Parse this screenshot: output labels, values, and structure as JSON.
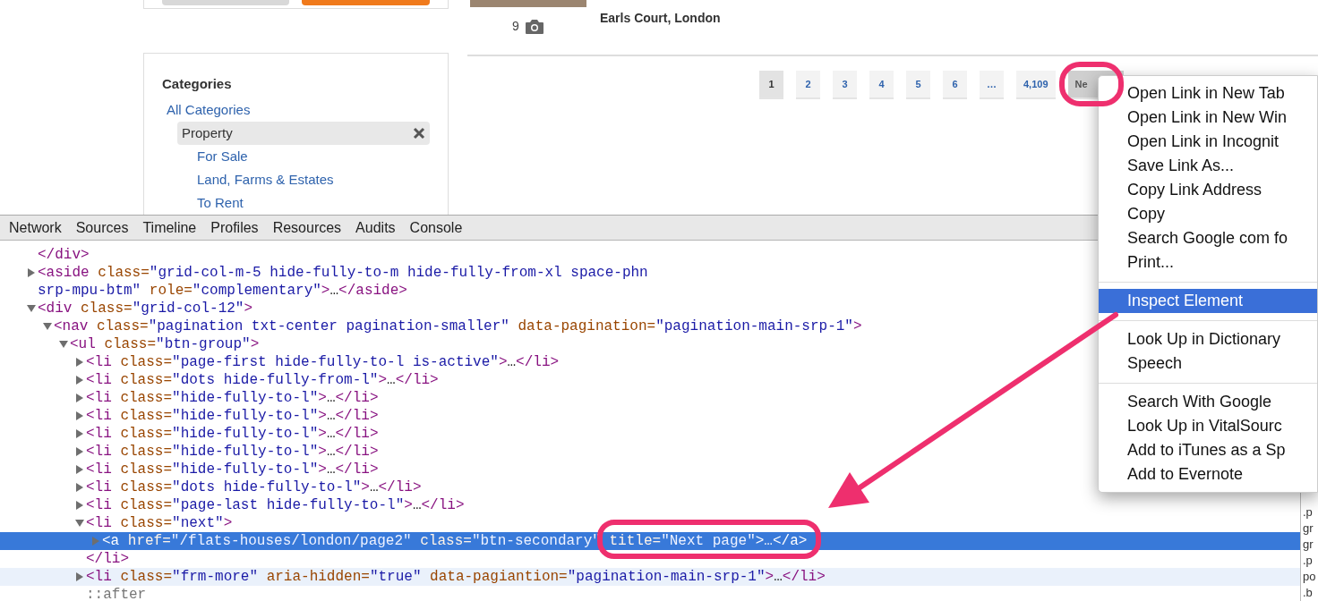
{
  "sidebar": {
    "title": "Categories",
    "items": [
      {
        "label": "All Categories",
        "selected": false,
        "children": [
          {
            "label": "Property",
            "selected": true,
            "children": [
              {
                "label": "For Sale",
                "selected": false
              },
              {
                "label": "Land, Farms & Estates",
                "selected": false
              },
              {
                "label": "To Rent",
                "selected": false
              }
            ]
          }
        ]
      }
    ]
  },
  "listing": {
    "photo_count": "9",
    "location": "Earls Court, London"
  },
  "pagination": [
    {
      "label": "1",
      "selected": true
    },
    {
      "label": "2",
      "selected": false
    },
    {
      "label": "3",
      "selected": false
    },
    {
      "label": "4",
      "selected": false
    },
    {
      "label": "5",
      "selected": false
    },
    {
      "label": "6",
      "selected": false
    },
    {
      "label": "…",
      "selected": false
    },
    {
      "label": "4,109",
      "selected": false
    },
    {
      "label": "Ne",
      "selected": false
    }
  ],
  "devtools": {
    "tabs": [
      "Network",
      "Sources",
      "Timeline",
      "Profiles",
      "Resources",
      "Audits",
      "Console"
    ],
    "tree": [
      {
        "selected": false,
        "hovered": false,
        "tokens": [
          {
            "kind": "tag",
            "text": "</div>"
          }
        ]
      },
      {
        "selected": false,
        "hovered": false,
        "expanded": false,
        "tokens": [
          {
            "kind": "tag",
            "text": "<aside"
          },
          {
            "kind": "attr",
            "text": " class="
          },
          {
            "kind": "value",
            "text": "\"grid-col-m-5 hide-fully-to-m hide-fully-from-xl space-phn srp-mpu-btm\""
          },
          {
            "kind": "attr",
            "text": " role="
          },
          {
            "kind": "value",
            "text": "\"complementary\""
          },
          {
            "kind": "tag",
            "text": ">"
          },
          {
            "kind": "text",
            "text": "…"
          },
          {
            "kind": "tag",
            "text": "</aside>"
          }
        ]
      },
      {
        "selected": false,
        "hovered": false,
        "expanded": true,
        "tokens": [
          {
            "kind": "tag",
            "text": "<div"
          },
          {
            "kind": "attr",
            "text": " class="
          },
          {
            "kind": "value",
            "text": "\"grid-col-12\""
          },
          {
            "kind": "tag",
            "text": ">"
          }
        ],
        "children": [
          {
            "selected": false,
            "hovered": false,
            "expanded": true,
            "tokens": [
              {
                "kind": "tag",
                "text": "<nav"
              },
              {
                "kind": "attr",
                "text": " class="
              },
              {
                "kind": "value",
                "text": "\"pagination txt-center pagination-smaller\""
              },
              {
                "kind": "attr",
                "text": " data-pagination="
              },
              {
                "kind": "value",
                "text": "\"pagination-main-srp-1\""
              },
              {
                "kind": "tag",
                "text": ">"
              }
            ],
            "children": [
              {
                "selected": false,
                "hovered": false,
                "expanded": true,
                "tokens": [
                  {
                    "kind": "tag",
                    "text": "<ul"
                  },
                  {
                    "kind": "attr",
                    "text": " class="
                  },
                  {
                    "kind": "value",
                    "text": "\"btn-group\""
                  },
                  {
                    "kind": "tag",
                    "text": ">"
                  }
                ],
                "children": [
                  {
                    "selected": false,
                    "hovered": false,
                    "expanded": false,
                    "tokens": [
                      {
                        "kind": "tag",
                        "text": "<li"
                      },
                      {
                        "kind": "attr",
                        "text": " class="
                      },
                      {
                        "kind": "value",
                        "text": "\"page-first hide-fully-to-l is-active\""
                      },
                      {
                        "kind": "tag",
                        "text": ">"
                      },
                      {
                        "kind": "text",
                        "text": "…"
                      },
                      {
                        "kind": "tag",
                        "text": "</li>"
                      }
                    ]
                  },
                  {
                    "selected": false,
                    "hovered": false,
                    "expanded": false,
                    "tokens": [
                      {
                        "kind": "tag",
                        "text": "<li"
                      },
                      {
                        "kind": "attr",
                        "text": " class="
                      },
                      {
                        "kind": "value",
                        "text": "\"dots hide-fully-from-l\""
                      },
                      {
                        "kind": "tag",
                        "text": ">"
                      },
                      {
                        "kind": "text",
                        "text": "…"
                      },
                      {
                        "kind": "tag",
                        "text": "</li>"
                      }
                    ]
                  },
                  {
                    "selected": false,
                    "hovered": false,
                    "expanded": false,
                    "tokens": [
                      {
                        "kind": "tag",
                        "text": "<li"
                      },
                      {
                        "kind": "attr",
                        "text": " class="
                      },
                      {
                        "kind": "value",
                        "text": "\"hide-fully-to-l\""
                      },
                      {
                        "kind": "tag",
                        "text": ">"
                      },
                      {
                        "kind": "text",
                        "text": "…"
                      },
                      {
                        "kind": "tag",
                        "text": "</li>"
                      }
                    ]
                  },
                  {
                    "selected": false,
                    "hovered": false,
                    "expanded": false,
                    "tokens": [
                      {
                        "kind": "tag",
                        "text": "<li"
                      },
                      {
                        "kind": "attr",
                        "text": " class="
                      },
                      {
                        "kind": "value",
                        "text": "\"hide-fully-to-l\""
                      },
                      {
                        "kind": "tag",
                        "text": ">"
                      },
                      {
                        "kind": "text",
                        "text": "…"
                      },
                      {
                        "kind": "tag",
                        "text": "</li>"
                      }
                    ]
                  },
                  {
                    "selected": false,
                    "hovered": false,
                    "expanded": false,
                    "tokens": [
                      {
                        "kind": "tag",
                        "text": "<li"
                      },
                      {
                        "kind": "attr",
                        "text": " class="
                      },
                      {
                        "kind": "value",
                        "text": "\"hide-fully-to-l\""
                      },
                      {
                        "kind": "tag",
                        "text": ">"
                      },
                      {
                        "kind": "text",
                        "text": "…"
                      },
                      {
                        "kind": "tag",
                        "text": "</li>"
                      }
                    ]
                  },
                  {
                    "selected": false,
                    "hovered": false,
                    "expanded": false,
                    "tokens": [
                      {
                        "kind": "tag",
                        "text": "<li"
                      },
                      {
                        "kind": "attr",
                        "text": " class="
                      },
                      {
                        "kind": "value",
                        "text": "\"hide-fully-to-l\""
                      },
                      {
                        "kind": "tag",
                        "text": ">"
                      },
                      {
                        "kind": "text",
                        "text": "…"
                      },
                      {
                        "kind": "tag",
                        "text": "</li>"
                      }
                    ]
                  },
                  {
                    "selected": false,
                    "hovered": false,
                    "expanded": false,
                    "tokens": [
                      {
                        "kind": "tag",
                        "text": "<li"
                      },
                      {
                        "kind": "attr",
                        "text": " class="
                      },
                      {
                        "kind": "value",
                        "text": "\"hide-fully-to-l\""
                      },
                      {
                        "kind": "tag",
                        "text": ">"
                      },
                      {
                        "kind": "text",
                        "text": "…"
                      },
                      {
                        "kind": "tag",
                        "text": "</li>"
                      }
                    ]
                  },
                  {
                    "selected": false,
                    "hovered": false,
                    "expanded": false,
                    "tokens": [
                      {
                        "kind": "tag",
                        "text": "<li"
                      },
                      {
                        "kind": "attr",
                        "text": " class="
                      },
                      {
                        "kind": "value",
                        "text": "\"dots hide-fully-to-l\""
                      },
                      {
                        "kind": "tag",
                        "text": ">"
                      },
                      {
                        "kind": "text",
                        "text": "…"
                      },
                      {
                        "kind": "tag",
                        "text": "</li>"
                      }
                    ]
                  },
                  {
                    "selected": false,
                    "hovered": false,
                    "expanded": false,
                    "tokens": [
                      {
                        "kind": "tag",
                        "text": "<li"
                      },
                      {
                        "kind": "attr",
                        "text": " class="
                      },
                      {
                        "kind": "value",
                        "text": "\"page-last hide-fully-to-l\""
                      },
                      {
                        "kind": "tag",
                        "text": ">"
                      },
                      {
                        "kind": "text",
                        "text": "…"
                      },
                      {
                        "kind": "tag",
                        "text": "</li>"
                      }
                    ]
                  },
                  {
                    "selected": false,
                    "hovered": false,
                    "expanded": true,
                    "tokens": [
                      {
                        "kind": "tag",
                        "text": "<li"
                      },
                      {
                        "kind": "attr",
                        "text": " class="
                      },
                      {
                        "kind": "value",
                        "text": "\"next\""
                      },
                      {
                        "kind": "tag",
                        "text": ">"
                      }
                    ],
                    "children": [
                      {
                        "selected": true,
                        "hovered": false,
                        "expanded": false,
                        "tokens": [
                          {
                            "kind": "tag",
                            "text": "<a"
                          },
                          {
                            "kind": "attr",
                            "text": " href="
                          },
                          {
                            "kind": "value",
                            "text": "\"/flats-houses/london/page2\""
                          },
                          {
                            "kind": "attr",
                            "text": " class="
                          },
                          {
                            "kind": "value",
                            "text": "\"btn-secondary\""
                          },
                          {
                            "kind": "attr",
                            "text": " title="
                          },
                          {
                            "kind": "value",
                            "text": "\"Next page\""
                          },
                          {
                            "kind": "tag",
                            "text": ">"
                          },
                          {
                            "kind": "text",
                            "text": "…"
                          },
                          {
                            "kind": "tag",
                            "text": "</a>"
                          }
                        ]
                      }
                    ],
                    "closing": [
                      {
                        "kind": "tag",
                        "text": "</li>"
                      }
                    ]
                  },
                  {
                    "selected": false,
                    "hovered": true,
                    "expanded": false,
                    "tokens": [
                      {
                        "kind": "tag",
                        "text": "<li"
                      },
                      {
                        "kind": "attr",
                        "text": " class="
                      },
                      {
                        "kind": "value",
                        "text": "\"frm-more\""
                      },
                      {
                        "kind": "attr",
                        "text": " aria-hidden="
                      },
                      {
                        "kind": "value",
                        "text": "\"true\""
                      },
                      {
                        "kind": "attr",
                        "text": " data-pagiantion="
                      },
                      {
                        "kind": "value",
                        "text": "\"pagination-main-srp-1\""
                      },
                      {
                        "kind": "tag",
                        "text": ">"
                      },
                      {
                        "kind": "text",
                        "text": "…"
                      },
                      {
                        "kind": "tag",
                        "text": "</li>"
                      }
                    ]
                  },
                  {
                    "selected": false,
                    "hovered": false,
                    "tokens": [
                      {
                        "kind": "pseudo",
                        "text": "::after"
                      }
                    ]
                  }
                ]
              }
            ]
          }
        ]
      }
    ],
    "side_pane": [
      ".p",
      "gr",
      "gr",
      ".p",
      "po",
      ".b"
    ]
  },
  "context_menu": [
    {
      "kind": "item",
      "label": "Open Link in New Tab",
      "selected": false
    },
    {
      "kind": "item",
      "label": "Open Link in New Win",
      "selected": false
    },
    {
      "kind": "item",
      "label": "Open Link in Incognit",
      "selected": false
    },
    {
      "kind": "item",
      "label": "Save Link As...",
      "selected": false
    },
    {
      "kind": "item",
      "label": "Copy Link Address",
      "selected": false
    },
    {
      "kind": "item",
      "label": "Copy",
      "selected": false
    },
    {
      "kind": "item",
      "label": "Search Google com fo",
      "selected": false
    },
    {
      "kind": "item",
      "label": "Print...",
      "selected": false
    },
    {
      "kind": "separator"
    },
    {
      "kind": "item",
      "label": "Inspect Element",
      "selected": true
    },
    {
      "kind": "separator"
    },
    {
      "kind": "item",
      "label": "Look Up in Dictionary",
      "selected": false
    },
    {
      "kind": "item",
      "label": "Speech",
      "selected": false
    },
    {
      "kind": "separator"
    },
    {
      "kind": "item",
      "label": "Search With Google",
      "selected": false
    },
    {
      "kind": "item",
      "label": "Look Up in VitalSourc",
      "selected": false
    },
    {
      "kind": "item",
      "label": "Add to iTunes as a Sp",
      "selected": false
    },
    {
      "kind": "item",
      "label": "Add to Evernote",
      "selected": false
    }
  ]
}
